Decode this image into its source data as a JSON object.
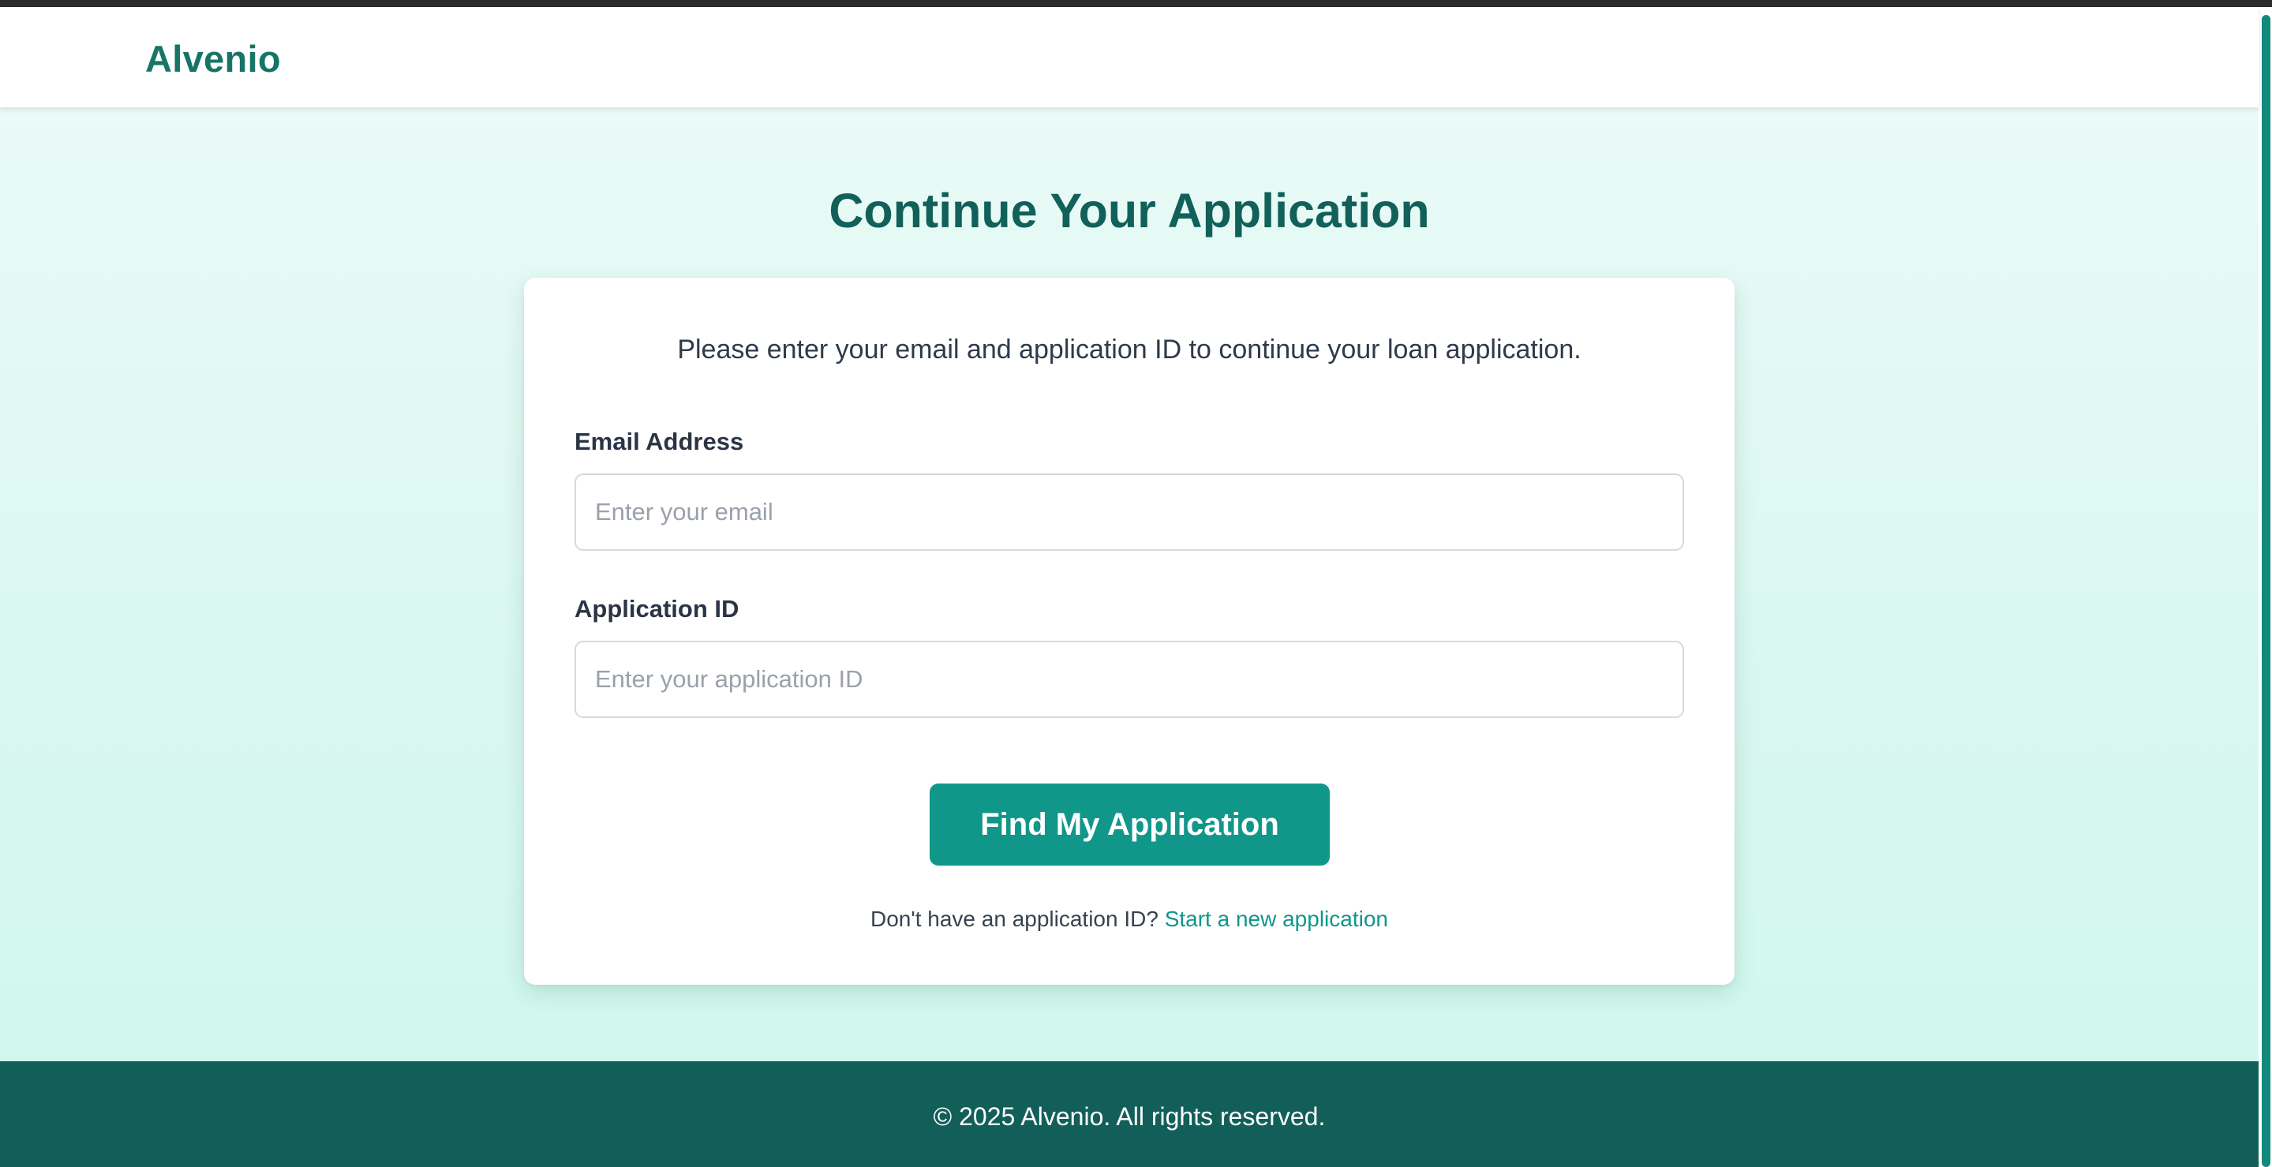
{
  "brand": {
    "name": "Alvenio",
    "primary_color": "#11978a",
    "dark_color": "#125f59",
    "title_color": "#11605a"
  },
  "page": {
    "title": "Continue Your Application"
  },
  "form": {
    "intro": "Please enter your email and application ID to continue your loan application.",
    "email": {
      "label": "Email Address",
      "placeholder": "Enter your email",
      "value": ""
    },
    "application_id": {
      "label": "Application ID",
      "placeholder": "Enter your application ID",
      "value": ""
    },
    "submit_label": "Find My Application",
    "helper_text": "Don't have an application ID?",
    "helper_link": "Start a new application"
  },
  "footer": {
    "copyright": "© 2025 Alvenio. All rights reserved."
  }
}
